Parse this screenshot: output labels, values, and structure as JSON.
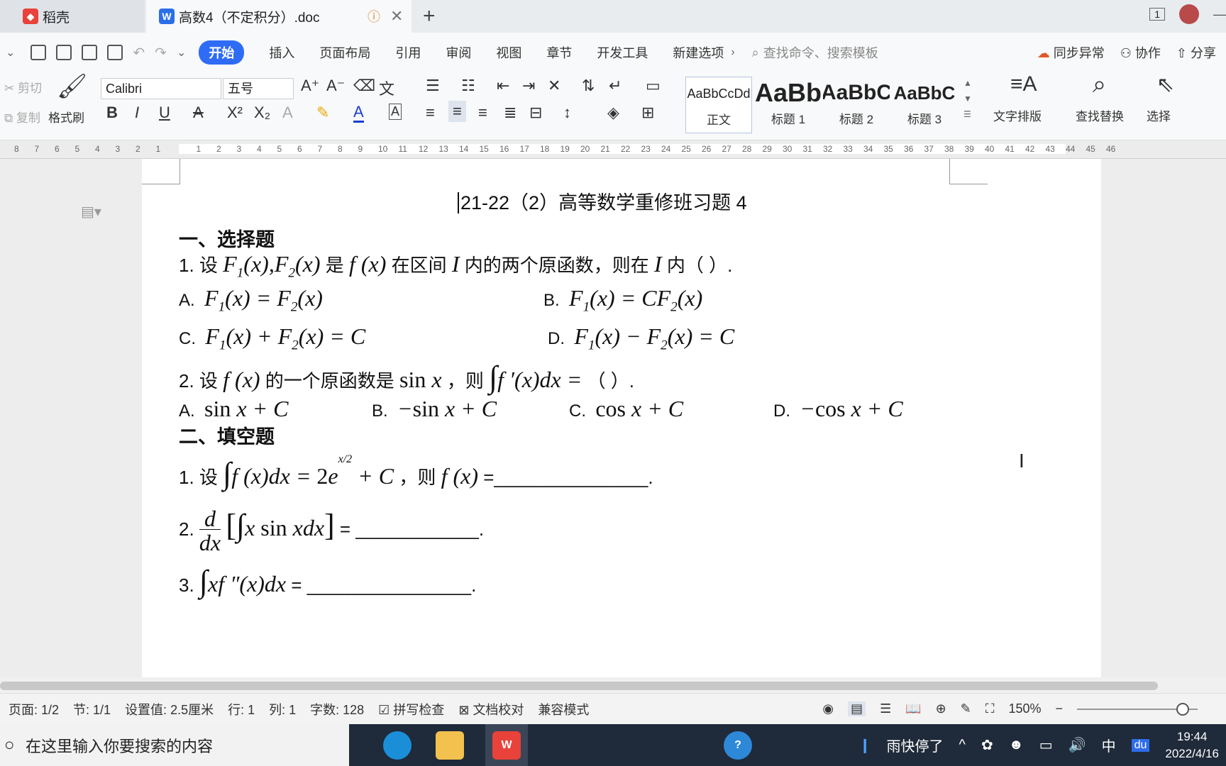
{
  "tabs": {
    "daoke": "稻壳",
    "doc": "高数4（不定积分）.doc",
    "new_tab": "+",
    "page_indicator": "1"
  },
  "menu": {
    "items": [
      "开始",
      "插入",
      "页面布局",
      "引用",
      "审阅",
      "视图",
      "章节",
      "开发工具",
      "新建选项"
    ],
    "search_placeholder": "查找命令、搜索模板",
    "sync": "同步异常",
    "collab": "协作",
    "share": "分享"
  },
  "ribbon": {
    "cut": "剪切",
    "copy": "复制",
    "format_painter": "格式刷",
    "font_name": "Calibri",
    "font_size": "五号",
    "styles": [
      {
        "sample": "AaBbCcDd",
        "label": "正文"
      },
      {
        "sample": "AaBb",
        "label": "标题 1"
      },
      {
        "sample": "AaBbC",
        "label": "标题 2"
      },
      {
        "sample": "AaBbC",
        "label": "标题 3"
      }
    ],
    "text_layout": "文字排版",
    "find_replace": "查找替换",
    "select": "选择"
  },
  "ruler": {
    "left_numbers": [
      "8",
      "7",
      "6",
      "5",
      "4",
      "3",
      "2",
      "1"
    ],
    "right_numbers": [
      "1",
      "2",
      "3",
      "4",
      "5",
      "6",
      "7",
      "8",
      "9",
      "10",
      "11",
      "12",
      "13",
      "14",
      "15",
      "16",
      "17",
      "18",
      "19",
      "20",
      "21",
      "22",
      "23",
      "24",
      "25",
      "26",
      "27",
      "28",
      "29",
      "30",
      "31",
      "32",
      "33",
      "34",
      "35",
      "36",
      "37",
      "38",
      "39",
      "40",
      "41",
      "42",
      "43",
      "44",
      "45",
      "46"
    ]
  },
  "document": {
    "title": "21-22（2）高等数学重修班习题 4",
    "section1": "一、选择题",
    "q1_text": "1.  设",
    "q1_math1": "F",
    "q1_mid": "是",
    "q1_rest": "在区间",
    "q1_rest2": "内的两个原函数，则在",
    "q1_rest3": "内（            ）.",
    "q1_options": [
      "A.",
      "B.",
      "C.",
      "D."
    ],
    "q2_text": "2.  设",
    "q2_rest": "的一个原函数是",
    "q2_rest2": "，则",
    "q2_rest3": "（            ）.",
    "q2_options": [
      "A.",
      "B.",
      "C.",
      "D."
    ],
    "section2": "二、填空题",
    "f1_label": "1.  设",
    "f1_rest": "，则",
    "f1_blank": "=_______________.",
    "f2_label": "2.",
    "f2_blank": "= ____________.",
    "f3_label": "3.",
    "f3_blank": "= ________________."
  },
  "status": {
    "page": "页面: 1/2",
    "section": "节: 1/1",
    "setting": "设置值: 2.5厘米",
    "row": "行: 1",
    "col": "列: 1",
    "words": "字数: 128",
    "spell": "拼写检查",
    "proof": "文档校对",
    "compat": "兼容模式",
    "zoom": "150%"
  },
  "taskbar": {
    "search_placeholder": "在这里输入你要搜索的内容",
    "weather": "雨快停了",
    "ime": "中",
    "time": "19:44",
    "date": "2022/4/16"
  },
  "colors": {
    "accent": "#2f6cf6",
    "taskbar": "#1f2a3a"
  }
}
